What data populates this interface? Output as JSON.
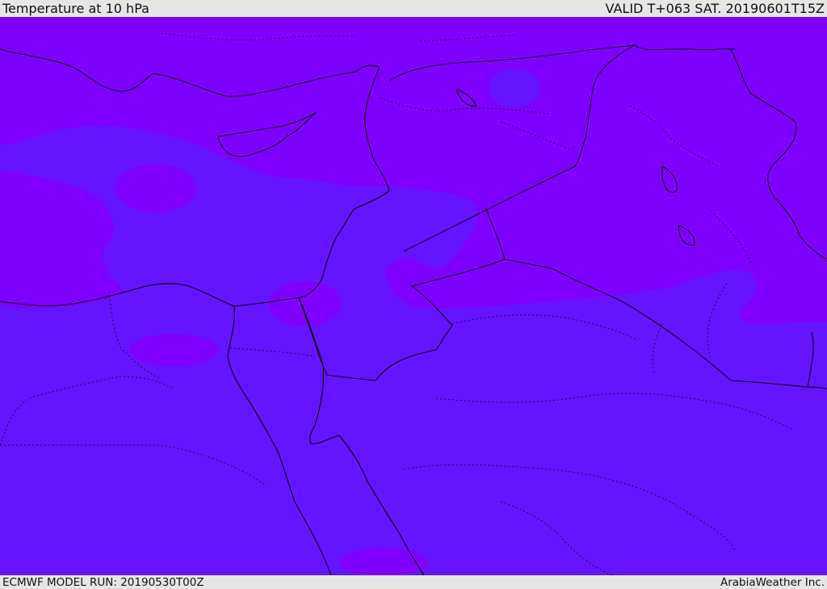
{
  "header": {
    "title": "Temperature at 10 hPa",
    "valid_time": "VALID T+063 SAT. 20190601T15Z"
  },
  "footer": {
    "model_run": "ECMWF MODEL RUN: 20190530T00Z",
    "credit": "ArabiaWeather Inc."
  },
  "map": {
    "colors": {
      "warm_zone": "#7f00ff",
      "cool_zone": "#6614ff",
      "coastline": "#000000",
      "borders": "#000000"
    }
  }
}
